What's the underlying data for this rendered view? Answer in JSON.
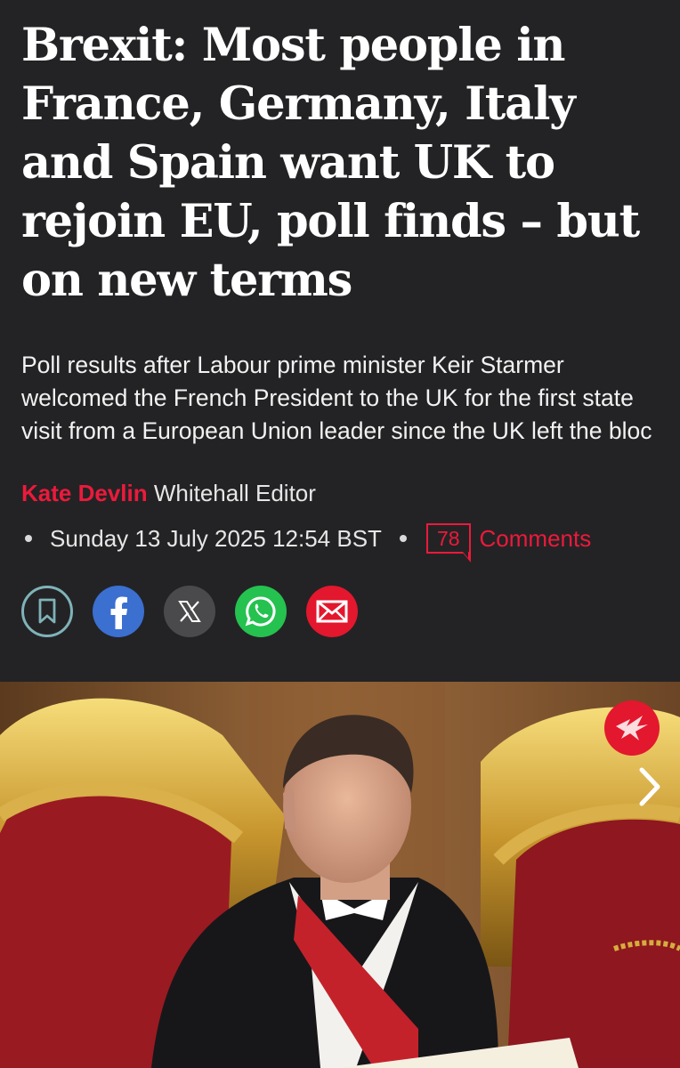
{
  "article": {
    "headline": "Brexit: Most people in France, Germany, Italy and Spain want UK to rejoin EU, poll finds – but on new terms",
    "standfirst": "Poll results after Labour prime minister Keir Starmer welcomed the French President to the UK for the first state visit from a European Union leader since the UK left the bloc",
    "author": "Kate Devlin",
    "author_role": "Whitehall Editor",
    "date": "Sunday 13 July 2025 12:54 BST",
    "comment_count": "78",
    "comments_label": "Comments"
  },
  "share": [
    {
      "name": "bookmark-icon"
    },
    {
      "name": "facebook-icon"
    },
    {
      "name": "x-icon"
    },
    {
      "name": "whatsapp-icon"
    },
    {
      "name": "email-icon"
    }
  ],
  "colors": {
    "background": "#232325",
    "accent": "#ec1a3b"
  },
  "media": {
    "hero_icon": "next-arrow-icon",
    "badge_icon": "independent-eagle-logo"
  }
}
